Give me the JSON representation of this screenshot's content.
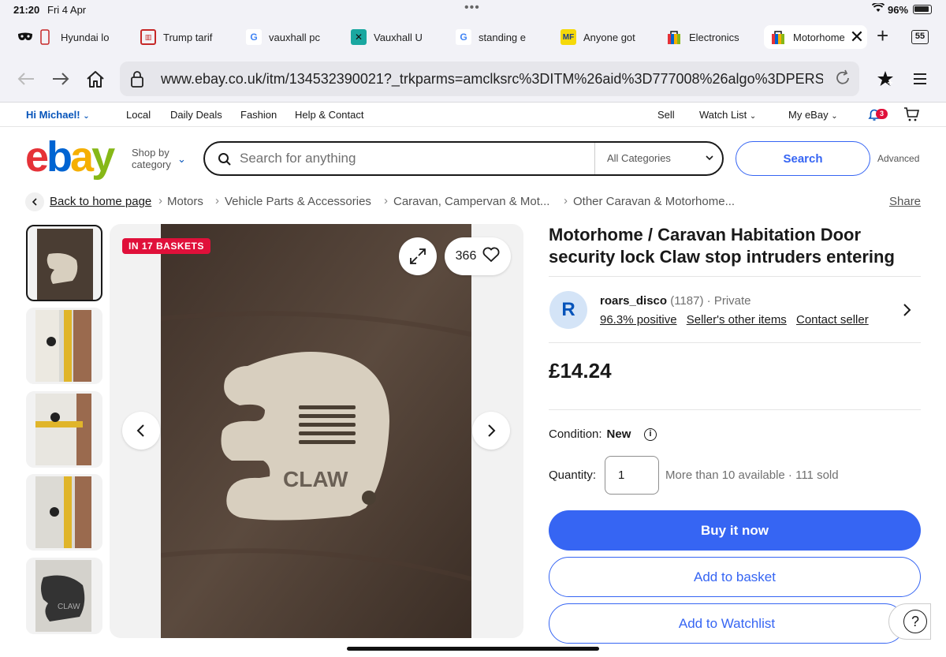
{
  "status": {
    "time": "21:20",
    "date": "Fri 4 Apr",
    "battery": "96%"
  },
  "tabs": [
    {
      "label": "Hyundai lo",
      "icon": "mask-icon"
    },
    {
      "label": "Trump tarif",
      "icon": "news-icon"
    },
    {
      "label": "vauxhall pc",
      "icon": "google-icon"
    },
    {
      "label": "Vauxhall U",
      "icon": "vauxhall-icon"
    },
    {
      "label": "standing e",
      "icon": "google-icon"
    },
    {
      "label": "Anyone got",
      "icon": "forum-icon"
    },
    {
      "label": "Electronics",
      "icon": "ebay-bag-icon"
    },
    {
      "label": "Motorhome",
      "icon": "ebay-bag-icon",
      "active": true
    }
  ],
  "tab_count": "55",
  "address": {
    "url": "www.ebay.co.uk/itm/134532390021?_trkparms=amclksrc%3DITM%26aid%3D777008%26algo%3DPERS..."
  },
  "topnav": {
    "greeting": "Hi Michael!",
    "links": [
      "Local",
      "Daily Deals",
      "Fashion",
      "Help & Contact"
    ],
    "sell": "Sell",
    "watch_list": "Watch List",
    "my_ebay": "My eBay",
    "notifications": "3"
  },
  "header": {
    "logo": {
      "e": "e",
      "b": "b",
      "a": "a",
      "y": "y"
    },
    "shop_by": "Shop by",
    "category": "category",
    "search_placeholder": "Search for anything",
    "category_select": "All Categories",
    "search_button": "Search",
    "advanced": "Advanced"
  },
  "breadcrumb": {
    "back": "Back to home page",
    "items": [
      "Motors",
      "Vehicle Parts & Accessories",
      "Caravan, Campervan & Mot...",
      "Other Caravan & Motorhome..."
    ],
    "share": "Share"
  },
  "gallery": {
    "badge": "IN 17 BASKETS",
    "watchers": "366",
    "product_text": "CLAW"
  },
  "product": {
    "title": "Motorhome / Caravan Habitation Door security lock Claw stop intruders entering",
    "seller": {
      "initial": "R",
      "name": "roars_disco",
      "feedback_count": "(1187)",
      "type": "Private",
      "positive": "96.3% positive",
      "other_items": "Seller's other items",
      "contact": "Contact seller"
    },
    "price": "£14.24",
    "condition_label": "Condition:",
    "condition_value": "New",
    "quantity_label": "Quantity:",
    "quantity_value": "1",
    "availability": "More than 10 available · 111 sold",
    "buy_now": "Buy it now",
    "add_to_basket": "Add to basket",
    "add_to_watchlist": "Add to Watchlist",
    "help": "?"
  },
  "colors": {
    "ebay_blue": "#3665f3",
    "link_blue": "#0654ba",
    "badge_red": "#e0103a"
  }
}
